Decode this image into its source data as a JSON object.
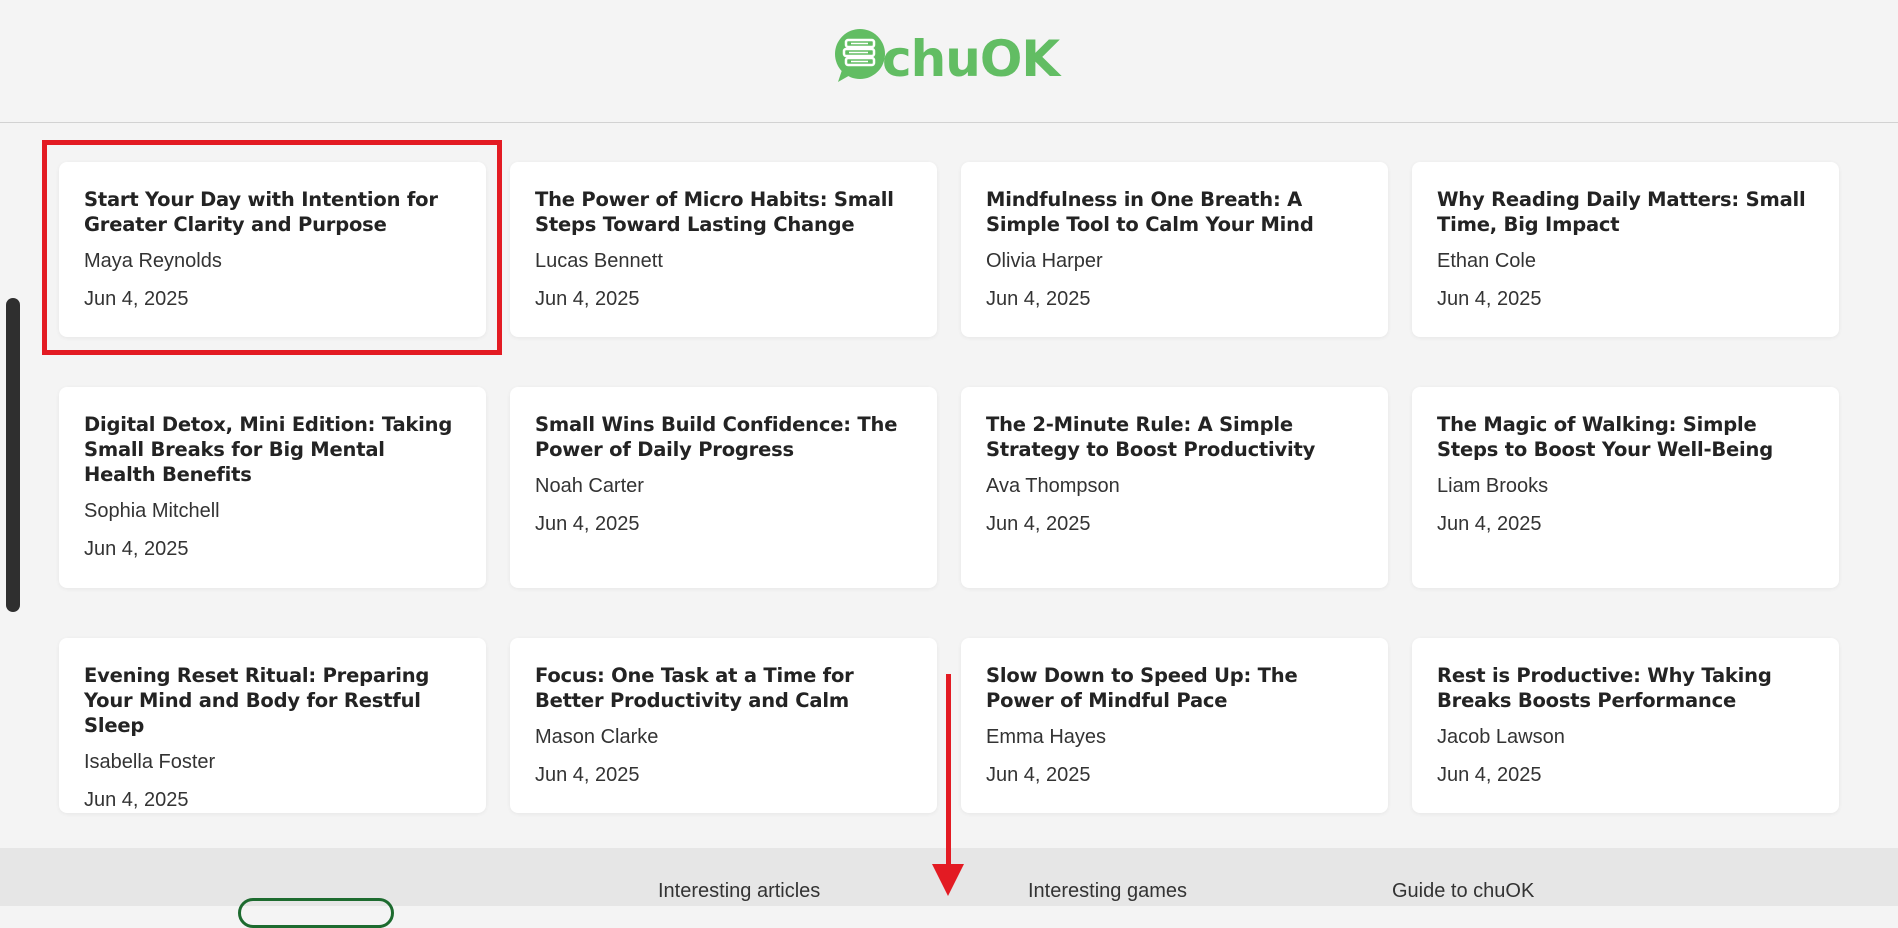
{
  "brand": {
    "name": "chuOK",
    "color": "#62bd63"
  },
  "articles": [
    {
      "title": "Start Your Day with Intention for Greater Clarity and Purpose",
      "author": "Maya Reynolds",
      "date": "Jun 4, 2025"
    },
    {
      "title": "The Power of Micro Habits: Small Steps Toward Lasting Change",
      "author": "Lucas Bennett",
      "date": "Jun 4, 2025"
    },
    {
      "title": "Mindfulness in One Breath: A Simple Tool to Calm Your Mind",
      "author": "Olivia Harper",
      "date": "Jun 4, 2025"
    },
    {
      "title": "Why Reading Daily Matters: Small Time, Big Impact",
      "author": "Ethan Cole",
      "date": "Jun 4, 2025"
    },
    {
      "title": "Digital Detox, Mini Edition: Taking Small Breaks for Big Mental Health Benefits",
      "author": "Sophia Mitchell",
      "date": "Jun 4, 2025"
    },
    {
      "title": "Small Wins Build Confidence: The Power of Daily Progress",
      "author": "Noah Carter",
      "date": "Jun 4, 2025"
    },
    {
      "title": "The 2-Minute Rule: A Simple Strategy to Boost Productivity",
      "author": "Ava Thompson",
      "date": "Jun 4, 2025"
    },
    {
      "title": "The Magic of Walking: Simple Steps to Boost Your Well-Being",
      "author": "Liam Brooks",
      "date": "Jun 4, 2025"
    },
    {
      "title": "Evening Reset Ritual: Preparing Your Mind and Body for Restful Sleep",
      "author": "Isabella Foster",
      "date": "Jun 4, 2025"
    },
    {
      "title": "Focus: One Task at a Time for Better Productivity and Calm",
      "author": "Mason Clarke",
      "date": "Jun 4, 2025"
    },
    {
      "title": "Slow Down to Speed Up: The Power of Mindful Pace",
      "author": "Emma Hayes",
      "date": "Jun 4, 2025"
    },
    {
      "title": "Rest is Productive: Why Taking Breaks Boosts Performance",
      "author": "Jacob Lawson",
      "date": "Jun 4, 2025"
    }
  ],
  "footer": {
    "links": [
      "Interesting articles",
      "Interesting games",
      "Guide to chuOK"
    ]
  },
  "annotations": {
    "highlight_color": "#e31b23"
  }
}
